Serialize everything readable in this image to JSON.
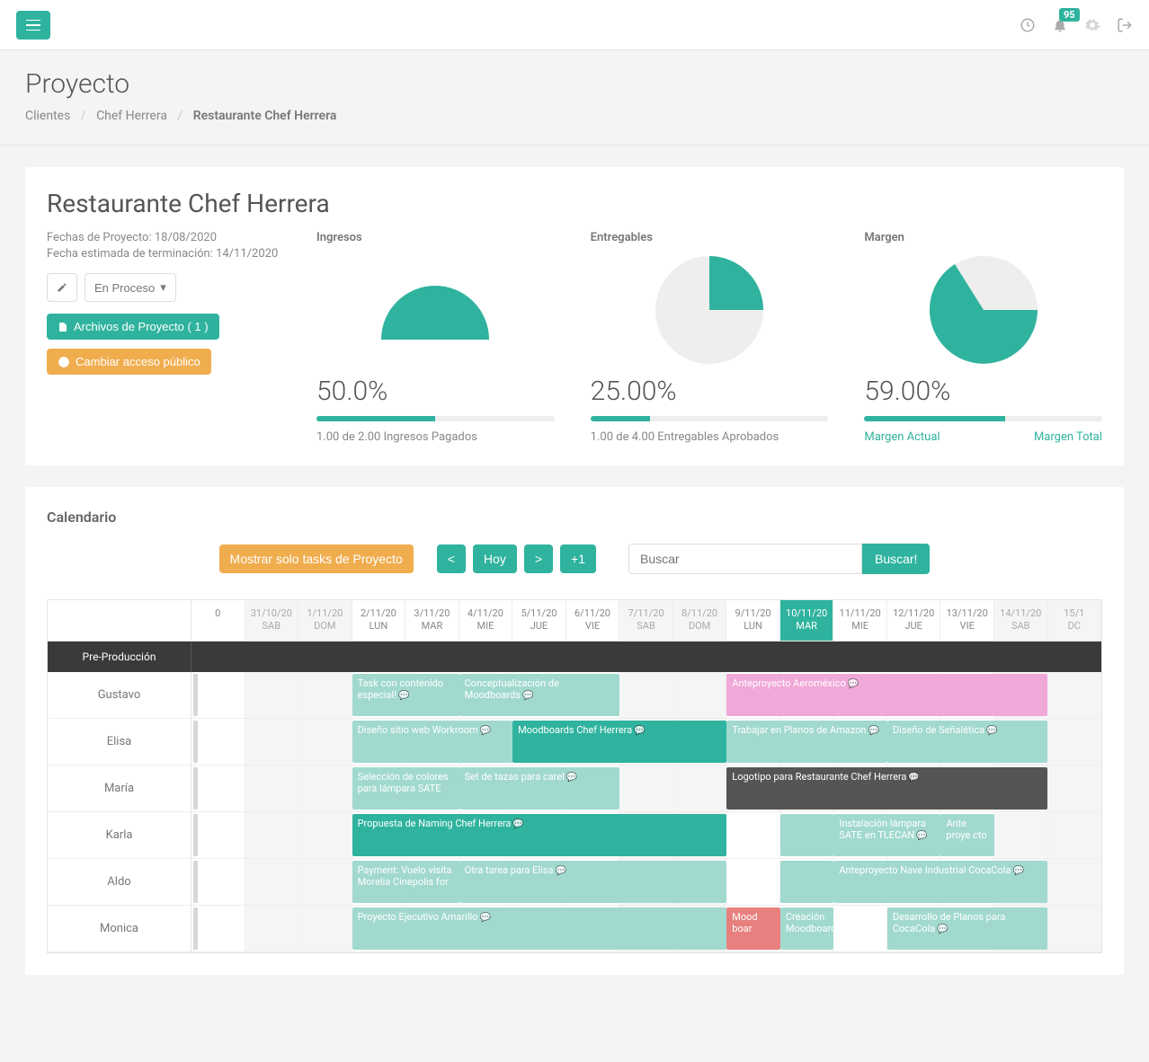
{
  "topbar": {
    "notification_count": "95"
  },
  "page": {
    "title": "Proyecto",
    "breadcrumb": {
      "level1": "Clientes",
      "level2": "Chef Herrera",
      "current": "Restaurante Chef Herrera"
    }
  },
  "project": {
    "title": "Restaurante Chef Herrera",
    "dates_label": "Fechas de Proyecto: 18/08/2020",
    "end_label": "Fecha estimada de terminación: 14/11/2020",
    "status": "En Proceso",
    "files_btn": "Archivos de Proyecto ( 1 )",
    "access_btn": "Cambiar acceso público"
  },
  "stats": {
    "ingresos": {
      "label": "Ingresos",
      "pct": "50.0%",
      "caption": "1.00 de 2.00 Ingresos Pagados"
    },
    "entregables": {
      "label": "Entregables",
      "pct": "25.00%",
      "caption": "1.00 de 4.00 Entregables Aprobados"
    },
    "margen": {
      "label": "Margen",
      "pct": "59.00%",
      "link1": "Margen Actual",
      "link2": "Margen Total"
    }
  },
  "chart_data": [
    {
      "type": "pie",
      "title": "Ingresos",
      "values": [
        50,
        50
      ],
      "display": "half"
    },
    {
      "type": "pie",
      "title": "Entregables",
      "values": [
        25,
        75
      ]
    },
    {
      "type": "pie",
      "title": "Margen",
      "values": [
        59,
        41
      ]
    }
  ],
  "calendar": {
    "title": "Calendario",
    "filter_btn": "Mostrar solo tasks de Proyecto",
    "prev": "<",
    "today": "Hoy",
    "next": ">",
    "plus": "+1",
    "search_placeholder": "Buscar",
    "search_btn": "Buscar!",
    "dates": [
      {
        "d": "0",
        "dow": ""
      },
      {
        "d": "31/10/20",
        "dow": "SAB",
        "weekend": true
      },
      {
        "d": "1/11/20",
        "dow": "DOM",
        "weekend": true
      },
      {
        "d": "2/11/20",
        "dow": "LUN"
      },
      {
        "d": "3/11/20",
        "dow": "MAR"
      },
      {
        "d": "4/11/20",
        "dow": "MIE"
      },
      {
        "d": "5/11/20",
        "dow": "JUE"
      },
      {
        "d": "6/11/20",
        "dow": "VIE"
      },
      {
        "d": "7/11/20",
        "dow": "SAB",
        "weekend": true
      },
      {
        "d": "8/11/20",
        "dow": "DOM",
        "weekend": true
      },
      {
        "d": "9/11/20",
        "dow": "LUN"
      },
      {
        "d": "10/11/20",
        "dow": "MAR",
        "today": true
      },
      {
        "d": "11/11/20",
        "dow": "MIE"
      },
      {
        "d": "12/11/20",
        "dow": "JUE"
      },
      {
        "d": "13/11/20",
        "dow": "VIE"
      },
      {
        "d": "14/11/20",
        "dow": "SAB",
        "weekend": true
      },
      {
        "d": "15/1",
        "dow": "DC",
        "weekend": true
      }
    ],
    "section": "Pre-Producción",
    "people": [
      {
        "name": "Gustavo",
        "tasks": [
          {
            "label": "Task con contenido especial!",
            "start": 3,
            "span": 2,
            "cls": "teal-light",
            "chat": true
          },
          {
            "label": "Conceptualización de Moodboards",
            "start": 5,
            "span": 3,
            "cls": "teal-light",
            "chat": true
          },
          {
            "label": "",
            "start": 10,
            "span": 1,
            "cls": "blue"
          },
          {
            "label": "Anteproyecto Aeroméxico",
            "start": 10,
            "span": 6,
            "cls": "pink",
            "chat": true
          }
        ]
      },
      {
        "name": "Elisa",
        "tasks": [
          {
            "label": "Diseño sitio web Workroom",
            "start": 3,
            "span": 3,
            "cls": "teal-light",
            "chat": true
          },
          {
            "label": "Moodboards Chef Herrera",
            "start": 6,
            "span": 4,
            "cls": "teal",
            "chat": true
          },
          {
            "label": "Trabajar en Planos de Amazon",
            "start": 10,
            "span": 3,
            "cls": "teal-light",
            "chat": true
          },
          {
            "label": "Diseño de Señalética",
            "start": 13,
            "span": 3,
            "cls": "teal-light",
            "chat": true
          }
        ]
      },
      {
        "name": "María",
        "tasks": [
          {
            "label": "Selección de colores para lámpara SATE",
            "start": 3,
            "span": 2,
            "cls": "teal-light"
          },
          {
            "label": "Set de tazas para carel",
            "start": 5,
            "span": 3,
            "cls": "teal-light",
            "chat": true
          },
          {
            "label": "Logotipo para Restaurante Chef Herrera",
            "start": 10,
            "span": 6,
            "cls": "dark",
            "chat": true
          }
        ]
      },
      {
        "name": "Karla",
        "tasks": [
          {
            "label": "Propuesta de Naming Chef Herrera",
            "start": 3,
            "span": 7,
            "cls": "teal",
            "chat": true
          },
          {
            "label": "",
            "start": 11,
            "span": 1,
            "cls": "teal-light"
          },
          {
            "label": "Instalación lámpara SATE en TLECAN",
            "start": 12,
            "span": 2,
            "cls": "teal-light",
            "chat": true
          },
          {
            "label": "Ante proye cto",
            "start": 14,
            "span": 1,
            "cls": "teal-light"
          }
        ]
      },
      {
        "name": "Aldo",
        "tasks": [
          {
            "label": "Payment: Vuelo visita Morelia Cinepolis for",
            "start": 3,
            "span": 2,
            "cls": "teal-light"
          },
          {
            "label": "Otra tarea para Elisa",
            "start": 5,
            "span": 5,
            "cls": "teal-light",
            "chat": true
          },
          {
            "label": "",
            "start": 11,
            "span": 1,
            "cls": "teal-light"
          },
          {
            "label": "Anteproyecto Nave Industrial CocaCola",
            "start": 12,
            "span": 4,
            "cls": "teal-light",
            "chat": true
          }
        ]
      },
      {
        "name": "Monica",
        "tasks": [
          {
            "label": "Proyecto Ejecutivo Amarillo",
            "start": 3,
            "span": 7,
            "cls": "teal-light",
            "chat": true
          },
          {
            "label": "Mood boar",
            "start": 10,
            "span": 1,
            "cls": "red"
          },
          {
            "label": "Creación Moodboards",
            "start": 11,
            "span": 1,
            "cls": "teal-light"
          },
          {
            "label": "Desarrollo de Planos para CocaCola",
            "start": 13,
            "span": 3,
            "cls": "teal-light",
            "chat": true
          }
        ]
      }
    ]
  }
}
